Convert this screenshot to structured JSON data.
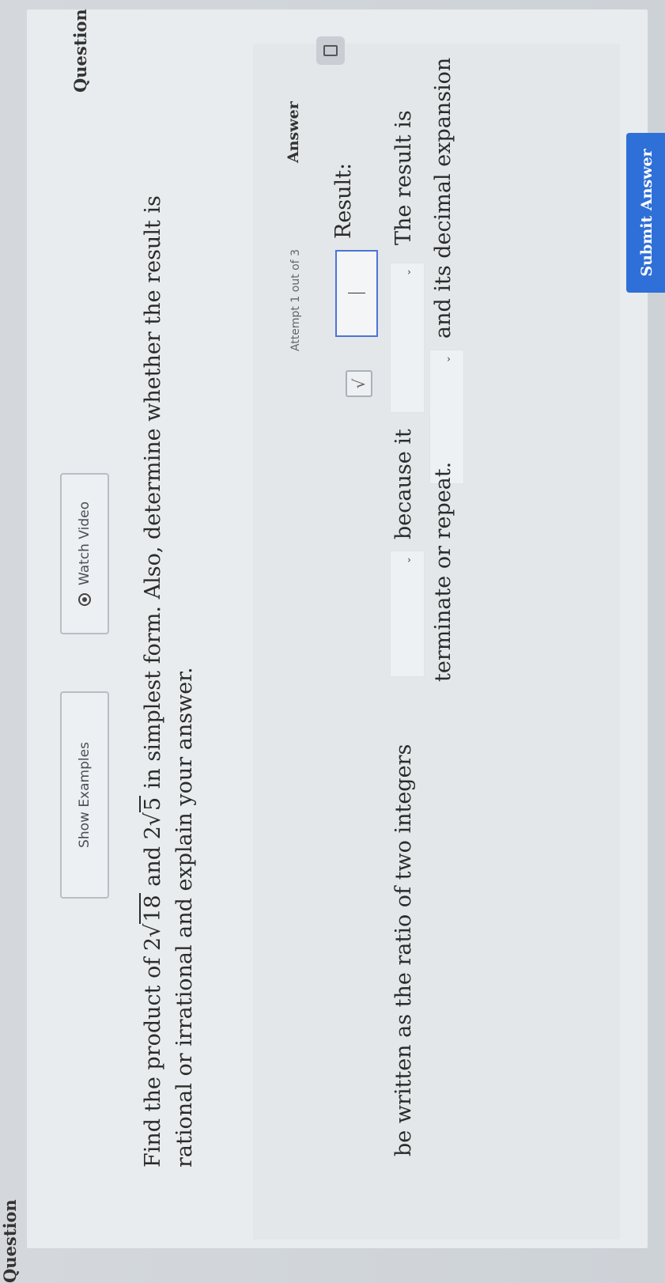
{
  "header": {
    "question_label": "Question",
    "watch_video_label": "Watch Video",
    "show_examples_label": "Show Examples"
  },
  "question": {
    "part1": "Find the product of 2",
    "rad1": "18",
    "part2": " and 2",
    "rad2": "5",
    "part3": " in simplest form. Also, determine whether the result is rational or irrational and explain your answer."
  },
  "answer": {
    "label": "Answer",
    "attempt": "Attempt 1 out of 3",
    "result_label": "Result:",
    "result_value": "",
    "sqrt_button": "√",
    "sentence1_a": "The result is",
    "sentence1_b": "because it",
    "sentence1_c": "be written as the ratio of two integers",
    "sentence2_a": "and its decimal expansion",
    "sentence2_b": "terminate or repeat.",
    "dropdown_chevron": "⌄"
  },
  "footer": {
    "submit_label": "Submit Answer"
  }
}
